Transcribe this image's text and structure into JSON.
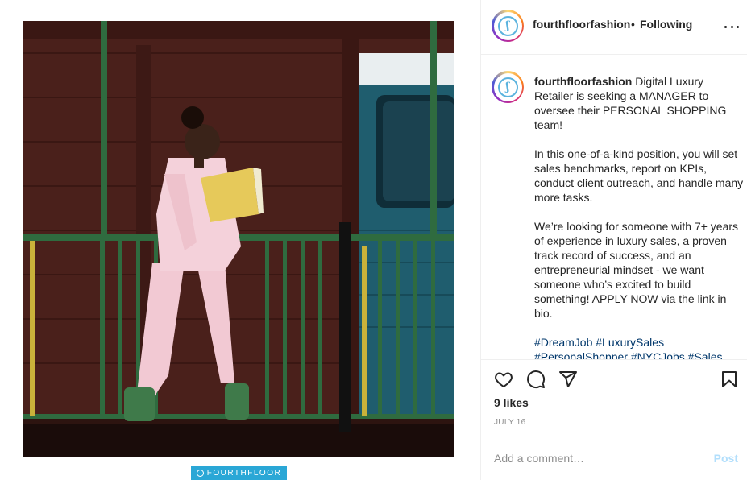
{
  "post": {
    "username": "fourthfloorfashion",
    "separator": "•",
    "follow_status": "Following",
    "brand_strip_text": "FOURTHFLOOR",
    "caption": {
      "username": "fourthfloorfashion",
      "p1": " Digital Luxury Retailer is seeking a MANAGER to oversee their PERSONAL SHOPPING team!",
      "p2": "In this one-of-a-kind position, you will set sales benchmarks, report on KPIs, conduct client outreach, and handle many more tasks.",
      "p3": "We’re looking for someone with 7+ years of experience in luxury sales, a proven track record of success, and an entrepreneurial mindset - we want someone who’s excited to build something! APPLY NOW via the link in bio.",
      "hashtags": "#DreamJob #LuxurySales #PersonalShopper #NYCJobs #Sales #CustomerService"
    },
    "likes": "9 likes",
    "date": "JULY 16",
    "comment_placeholder": "Add a comment…",
    "post_button": "Post"
  },
  "icons": {
    "like": "heart-icon",
    "comment": "comment-icon",
    "share": "paper-plane-icon",
    "save": "bookmark-icon",
    "more": "more-options-icon"
  },
  "colors": {
    "text": "#262626",
    "muted": "#8e8e8e",
    "hashtag": "#00376b",
    "post_disabled": "#b2dffc",
    "brand_blue": "#2aa7d6",
    "divider": "#efefef"
  }
}
